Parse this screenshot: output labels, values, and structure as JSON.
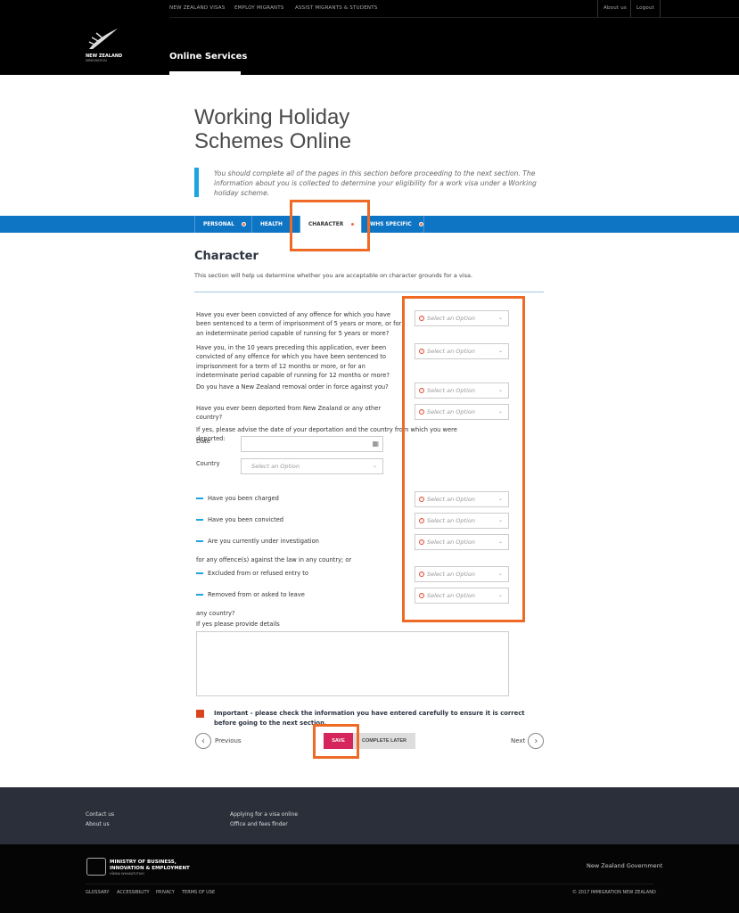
{
  "header": {
    "top_nav": [
      "NEW ZEALAND VISAS",
      "EMPLOY MIGRANTS",
      "ASSIST MIGRANTS & STUDENTS"
    ],
    "about": "About us",
    "logout": "Logout",
    "logo_line1": "NEW ZEALAND",
    "logo_line2": "IMMIGRATION",
    "section": "Online Services"
  },
  "page": {
    "title_line1": "Working Holiday",
    "title_line2": "Schemes Online",
    "info": "You should complete all of the pages in this section before proceeding to the next section. The information about you is collected to determine your eligibility for a work visa under a Working holiday scheme."
  },
  "tabs": [
    {
      "label": "PERSONAL",
      "error": true
    },
    {
      "label": "HEALTH",
      "error": false
    },
    {
      "label": "CHARACTER",
      "error": true,
      "active": true
    },
    {
      "label": "WHS SPECIFIC",
      "error": true
    }
  ],
  "form": {
    "heading": "Character",
    "description": "This section will help us determine whether you are acceptable on character grounds for a visa.",
    "placeholder": "Select an Option",
    "questions": [
      "Have you ever been convicted of any offence for which you have been sentenced to a term of imprisonment of 5 years or more, or for an indeterminate period capable of running for 5 years or more?",
      "Have you, in the 10 years preceding this application, ever been convicted of any offence for which you have been sentenced to imprisonment for a term of 12 months or more, or for an indeterminate period capable of running for 12 months or more?",
      "Do you have a New Zealand removal order in force against you?",
      "Have you ever been deported from New Zealand or any other country?"
    ],
    "deport_note": "If yes, please advise the date of your deportation and the country from which you were deported:",
    "date_label": "Date",
    "country_label": "Country",
    "sub_questions": [
      "Have you been charged",
      "Have you been convicted",
      "Are you currently under investigation",
      "Excluded from or refused entry to",
      "Removed from or asked to leave"
    ],
    "for_any": "for any offence(s) against the law in any country; or",
    "any_country": "any country?",
    "details_label": "If yes please provide details",
    "important": "Important - please check the information you have entered carefully to ensure it is correct before going to the next section.",
    "previous": "Previous",
    "save": "SAVE",
    "complete_later": "COMPLETE LATER",
    "next": "Next"
  },
  "footer": {
    "links1": [
      "Contact us",
      "About us"
    ],
    "links2": [
      "Applying for a visa online",
      "Office and fees finder"
    ],
    "mbie1": "MINISTRY OF BUSINESS,",
    "mbie2": "INNOVATION & EMPLOYMENT",
    "mbie3": "HĪKINA WHAKATUTUKI",
    "govt": "New Zealand Government",
    "bottom": [
      "GLOSSARY",
      "ACCESSIBILITY",
      "PRIVACY",
      "TERMS OF USE"
    ],
    "copyright": "© 2017 IMMIGRATION NEW ZEALAND"
  },
  "colors": {
    "accent_blue": "#0e74c4",
    "save_pink": "#d6245c",
    "highlight_orange": "#ee6a25",
    "error": "#e0492f"
  }
}
